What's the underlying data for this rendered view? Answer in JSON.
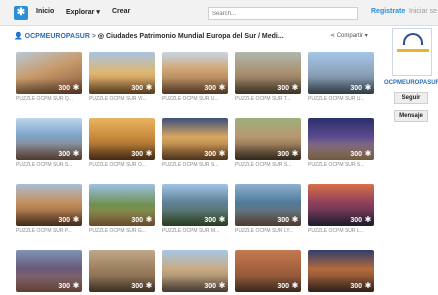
{
  "header": {
    "nav": [
      "Inicio",
      "Explorar ▾",
      "Crear"
    ],
    "search_placeholder": "Search...",
    "register": "Registrate",
    "login": "Iniciar se"
  },
  "breadcrumb": {
    "user": "OCPMEUROPASUR",
    "separator": ">",
    "title": "Ciudades Patrimonio Mundial Europa del Sur / Medi...",
    "share": "Compartir"
  },
  "puzzles": [
    {
      "caption": "PUZZLE OCPM SUR Q...",
      "count": "300"
    },
    {
      "caption": "PUZZLE OCPM SUR VI...",
      "count": "300"
    },
    {
      "caption": "PUZZLE OCPM SUR U...",
      "count": "300"
    },
    {
      "caption": "PUZZLE OCPM SUR T...",
      "count": "300"
    },
    {
      "caption": "PUZZLE OCPM SUR U...",
      "count": "300"
    },
    {
      "caption": "PUZZLE OCPM SUR S...",
      "count": "300"
    },
    {
      "caption": "PUZZLE OCPM SUR O...",
      "count": "300"
    },
    {
      "caption": "PUZZLE OCPM SUR S...",
      "count": "300"
    },
    {
      "caption": "PUZZLE OCPM SUR S...",
      "count": "300"
    },
    {
      "caption": "PUZZLE OCPM SUR S...",
      "count": "300"
    },
    {
      "caption": "PUZZLE OCPM SUR P...",
      "count": "300"
    },
    {
      "caption": "PUZZLE OCPM SUR G...",
      "count": "300"
    },
    {
      "caption": "PUZZLE OCPM SUR M...",
      "count": "300"
    },
    {
      "caption": "PUZZLE OCPM SUR LY...",
      "count": "300"
    },
    {
      "caption": "PUZZLE OCPM SUR L...",
      "count": "300"
    },
    {
      "caption": "",
      "count": "300"
    },
    {
      "caption": "",
      "count": "300"
    },
    {
      "caption": "",
      "count": "300"
    },
    {
      "caption": "",
      "count": "300"
    },
    {
      "caption": "",
      "count": "300"
    }
  ],
  "sidebar": {
    "username": "OCPMEUROPASUR",
    "follow": "Seguir",
    "message": "Mensaje"
  },
  "colors": {
    "accent": "#2a6fb6",
    "brand": "#2a8fd6"
  }
}
